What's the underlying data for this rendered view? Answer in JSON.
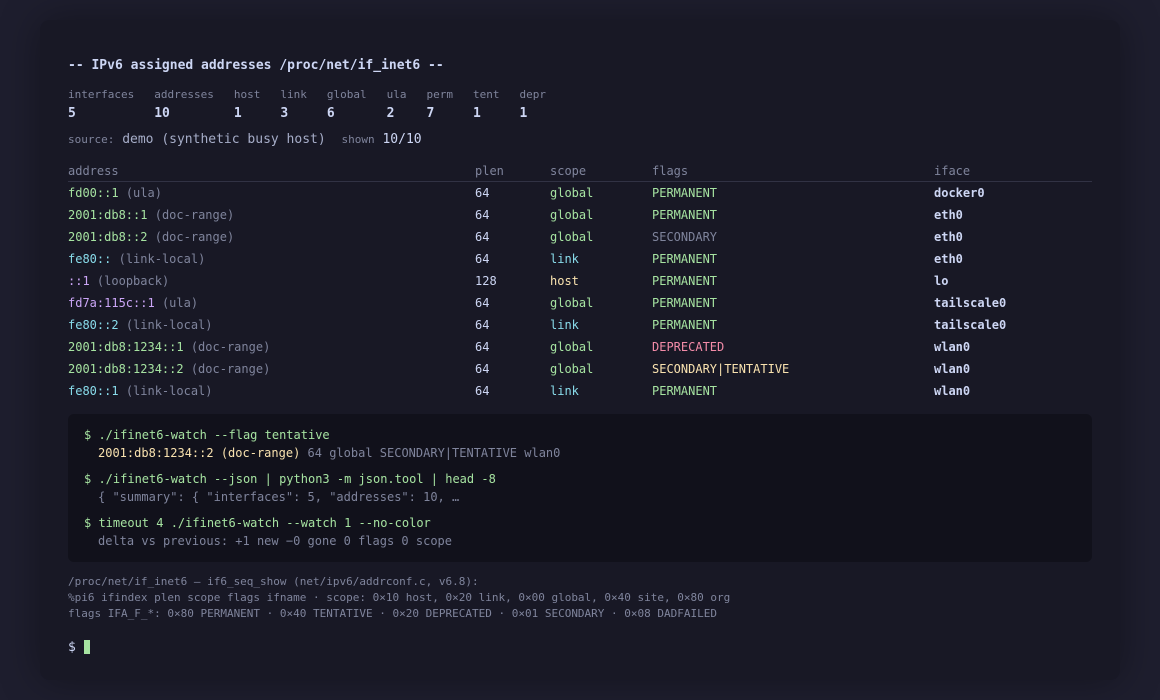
{
  "title": "-- IPv6 assigned addresses /proc/net/if_inet6 --",
  "stats": [
    {
      "label": "interfaces",
      "value": "5"
    },
    {
      "label": "addresses",
      "value": "10"
    },
    {
      "label": "host",
      "value": "1"
    },
    {
      "label": "link",
      "value": "3"
    },
    {
      "label": "global",
      "value": "6"
    },
    {
      "label": "ula",
      "value": "2"
    },
    {
      "label": "perm",
      "value": "7"
    },
    {
      "label": "tent",
      "value": "1"
    },
    {
      "label": "depr",
      "value": "1"
    }
  ],
  "source": {
    "label": "source:",
    "value": "demo (synthetic busy host)",
    "shown_label": "shown",
    "shown_value": "10/10"
  },
  "columns": {
    "address": "address",
    "plen": "plen",
    "scope": "scope",
    "flags": "flags",
    "iface": "iface"
  },
  "colors": {
    "global": "#a6e3a1",
    "link": "#89dceb",
    "host": "#f9e2af",
    "ula": "#cba6f7",
    "loopback": "#cba6f7",
    "permanent": "#a6e3a1",
    "secondary": "#7f849c",
    "deprecated": "#f38ba8",
    "secondary_tentative": "#f9e2af"
  },
  "rows": [
    {
      "addr": "fd00::1",
      "annot": "(ula)",
      "addr_color": "#a6e3a1",
      "plen": "64",
      "scope": "global",
      "scope_color": "#a6e3a1",
      "flags": "PERMANENT",
      "flags_color": "#a6e3a1",
      "iface": "docker0"
    },
    {
      "addr": "2001:db8::1",
      "annot": "(doc-range)",
      "addr_color": "#a6e3a1",
      "plen": "64",
      "scope": "global",
      "scope_color": "#a6e3a1",
      "flags": "PERMANENT",
      "flags_color": "#a6e3a1",
      "iface": "eth0"
    },
    {
      "addr": "2001:db8::2",
      "annot": "(doc-range)",
      "addr_color": "#a6e3a1",
      "plen": "64",
      "scope": "global",
      "scope_color": "#a6e3a1",
      "flags": "SECONDARY",
      "flags_color": "#7f849c",
      "iface": "eth0"
    },
    {
      "addr": "fe80::",
      "annot": "(link-local)",
      "addr_color": "#89dceb",
      "plen": "64",
      "scope": "link",
      "scope_color": "#89dceb",
      "flags": "PERMANENT",
      "flags_color": "#a6e3a1",
      "iface": "eth0"
    },
    {
      "addr": "::1",
      "annot": "(loopback)",
      "addr_color": "#cba6f7",
      "plen": "128",
      "scope": "host",
      "scope_color": "#f9e2af",
      "flags": "PERMANENT",
      "flags_color": "#a6e3a1",
      "iface": "lo"
    },
    {
      "addr": "fd7a:115c::1",
      "annot": "(ula)",
      "addr_color": "#cba6f7",
      "plen": "64",
      "scope": "global",
      "scope_color": "#a6e3a1",
      "flags": "PERMANENT",
      "flags_color": "#a6e3a1",
      "iface": "tailscale0"
    },
    {
      "addr": "fe80::2",
      "annot": "(link-local)",
      "addr_color": "#89dceb",
      "plen": "64",
      "scope": "link",
      "scope_color": "#89dceb",
      "flags": "PERMANENT",
      "flags_color": "#a6e3a1",
      "iface": "tailscale0"
    },
    {
      "addr": "2001:db8:1234::1",
      "annot": "(doc-range)",
      "addr_color": "#a6e3a1",
      "plen": "64",
      "scope": "global",
      "scope_color": "#a6e3a1",
      "flags": "DEPRECATED",
      "flags_color": "#f38ba8",
      "iface": "wlan0"
    },
    {
      "addr": "2001:db8:1234::2",
      "annot": "(doc-range)",
      "addr_color": "#a6e3a1",
      "plen": "64",
      "scope": "global",
      "scope_color": "#a6e3a1",
      "flags": "SECONDARY|TENTATIVE",
      "flags_color": "#f9e2af",
      "iface": "wlan0"
    },
    {
      "addr": "fe80::1",
      "annot": "(link-local)",
      "addr_color": "#89dceb",
      "plen": "64",
      "scope": "link",
      "scope_color": "#89dceb",
      "flags": "PERMANENT",
      "flags_color": "#a6e3a1",
      "iface": "wlan0"
    }
  ],
  "commands": [
    {
      "cmd": "$ ./ifinet6-watch --flag tentative",
      "output_hl": "2001:db8:1234::2 (doc-range)",
      "output": " 64 global SECONDARY|TENTATIVE wlan0"
    },
    {
      "cmd": "$ ./ifinet6-watch --json | python3 -m json.tool | head -8",
      "output_hl": "",
      "output": "{ \"summary\": { \"interfaces\": 5, \"addresses\": 10, …"
    },
    {
      "cmd": "$ timeout 4 ./ifinet6-watch --watch 1 --no-color",
      "output_hl": "",
      "output": "delta vs previous: +1 new −0 gone 0 flags 0 scope"
    }
  ],
  "footer": [
    "/proc/net/if_inet6 — if6_seq_show (net/ipv6/addrconf.c, v6.8):",
    "%pi6 ifindex plen scope flags ifname  ·  scope: 0×10 host, 0×20 link, 0×00 global, 0×40 site, 0×80 org",
    "flags IFA_F_*: 0×80 PERMANENT · 0×40 TENTATIVE · 0×20 DEPRECATED · 0×01 SECONDARY · 0×08 DADFAILED"
  ],
  "prompt": "$"
}
